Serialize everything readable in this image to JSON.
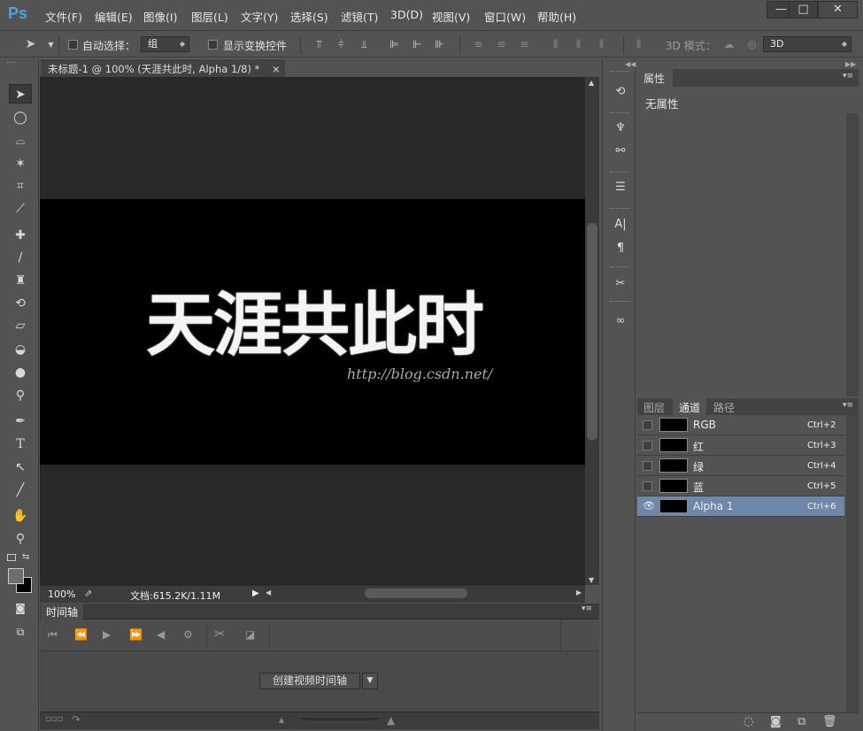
{
  "app": {
    "logo": "Ps"
  },
  "menu": [
    "文件(F)",
    "编辑(E)",
    "图像(I)",
    "图层(L)",
    "文字(Y)",
    "选择(S)",
    "滤镜(T)",
    "3D(D)",
    "视图(V)",
    "窗口(W)",
    "帮助(H)"
  ],
  "window_controls": {
    "minimize": "—",
    "maximize": "□",
    "close": "✕"
  },
  "options": {
    "auto_select_label": "自动选择：",
    "auto_select_value": "组",
    "show_transform_label": "显示变换控件",
    "mode3d_label": "3D 模式：",
    "mode3d_value": "3D"
  },
  "document": {
    "tab_title": "未标题-1 @ 100% (天涯共此时, Alpha 1/8) *",
    "tab_close": "×",
    "canvas_text": "天涯共此时",
    "watermark": "http://blog.csdn.net/"
  },
  "status": {
    "zoom": "100%",
    "doc_info": "文档:615.2K/1.11M"
  },
  "timeline": {
    "title": "时间轴",
    "create_button": "创建视频时间轴"
  },
  "properties": {
    "tab": "属性",
    "empty_text": "无属性"
  },
  "panels": {
    "tabs": [
      "图层",
      "通道",
      "路径"
    ],
    "active_tab": "通道",
    "channels": [
      {
        "name": "RGB",
        "shortcut": "Ctrl+2",
        "visible": false
      },
      {
        "name": "红",
        "shortcut": "Ctrl+3",
        "visible": false
      },
      {
        "name": "绿",
        "shortcut": "Ctrl+4",
        "visible": false
      },
      {
        "name": "蓝",
        "shortcut": "Ctrl+5",
        "visible": false
      },
      {
        "name": "Alpha 1",
        "shortcut": "Ctrl+6",
        "visible": true,
        "selected": true
      }
    ]
  },
  "colors": {
    "ps_blue": "#4aa3e3",
    "selected_row": "#6f87a8",
    "canvas": "#000000"
  }
}
